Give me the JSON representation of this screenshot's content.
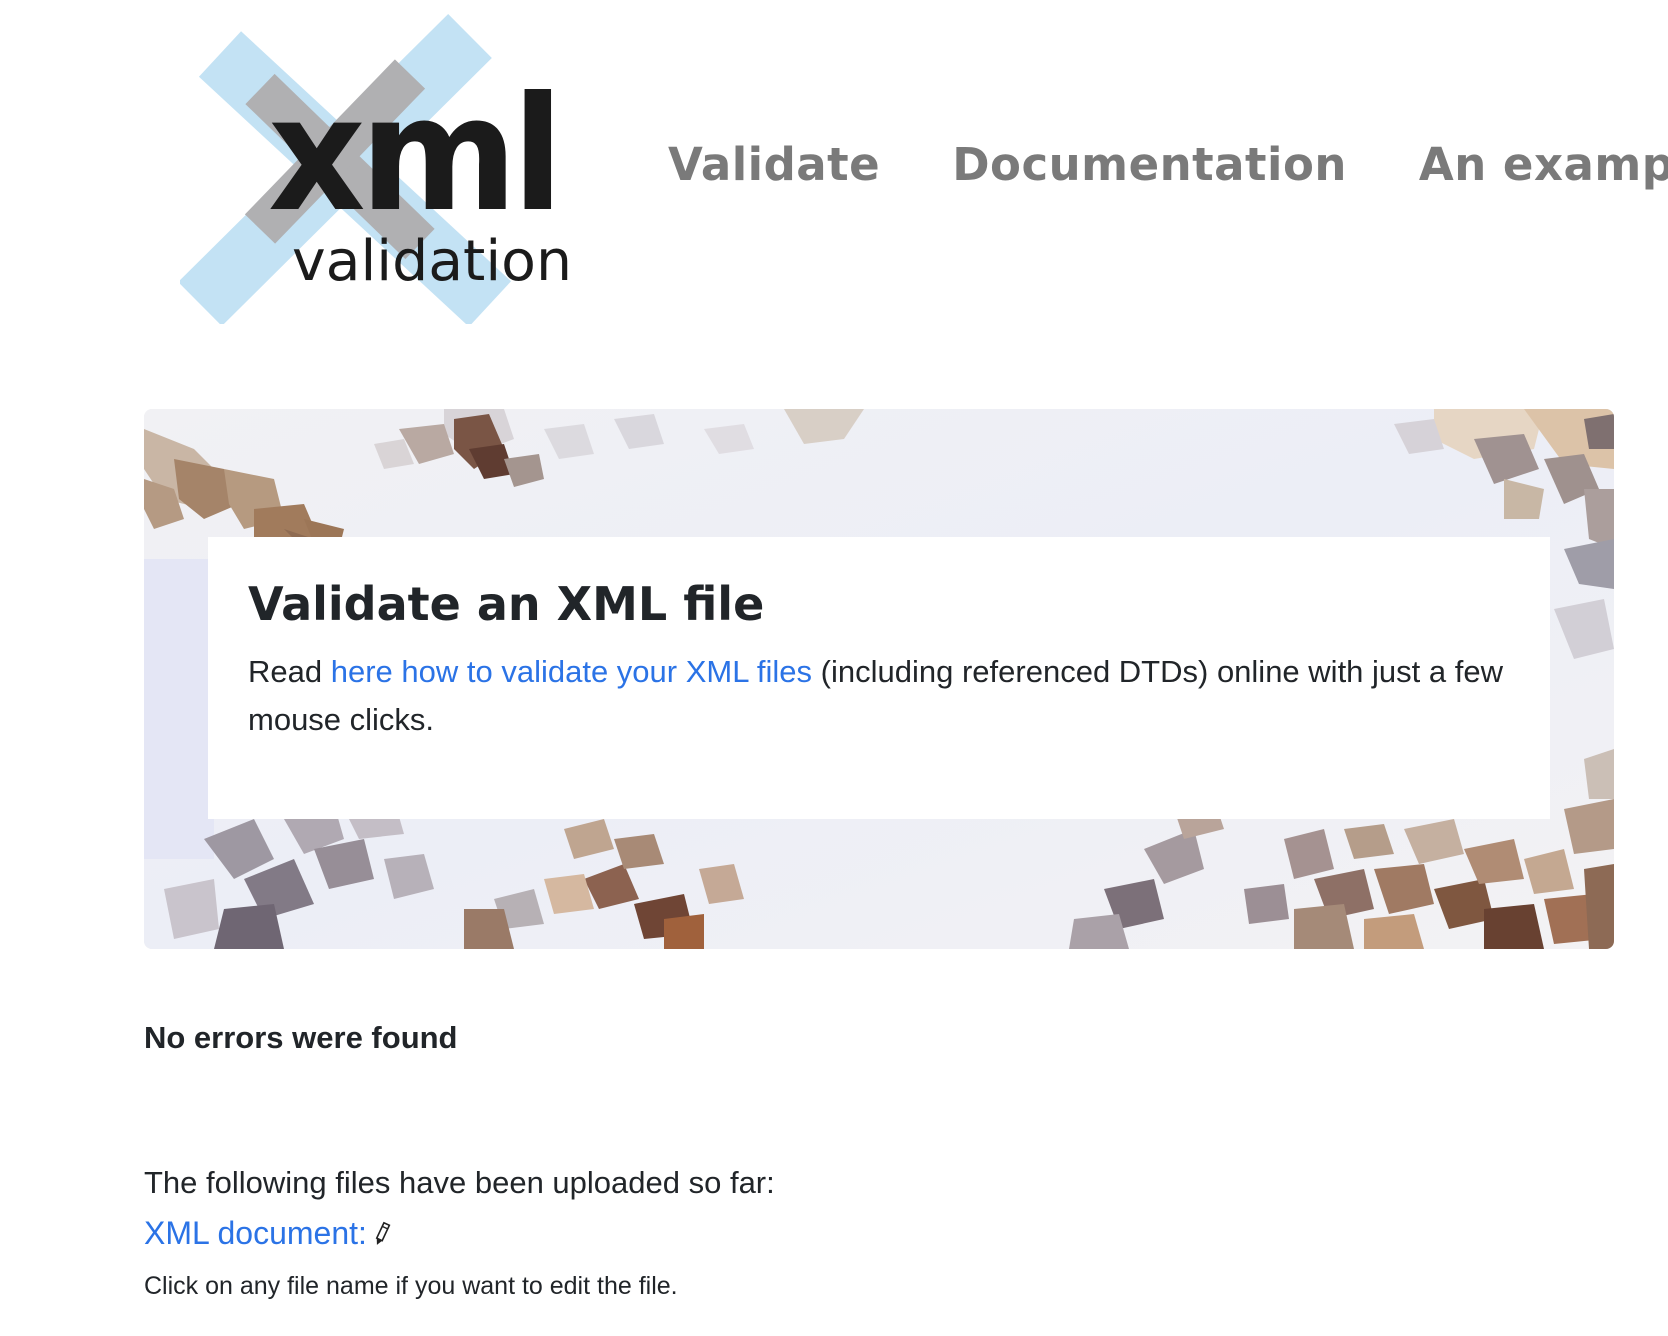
{
  "header": {
    "logo": {
      "wordmark": "xml",
      "subtitle": "validation"
    },
    "nav": [
      {
        "label": "Validate"
      },
      {
        "label": "Documentation"
      },
      {
        "label": "An example"
      }
    ]
  },
  "hero": {
    "title": "Validate an XML file",
    "text_before": "Read ",
    "link_text": "here how to validate your XML files",
    "text_after": " (including referenced DTDs) online with just a few mouse clicks."
  },
  "result": {
    "status": "No errors were found"
  },
  "uploads": {
    "intro": "The following files have been uploaded so far:",
    "files": [
      {
        "label": "XML document:",
        "icon": "pencil-icon"
      }
    ],
    "hint": "Click on any file name if you want to edit the file."
  },
  "colors": {
    "link": "#2b73e6",
    "nav": "#7a7a7a",
    "text": "#212529",
    "logo_light_blue": "#c3e2f4",
    "logo_gray": "#b0b0b2",
    "logo_dark": "#1b1b1b"
  }
}
